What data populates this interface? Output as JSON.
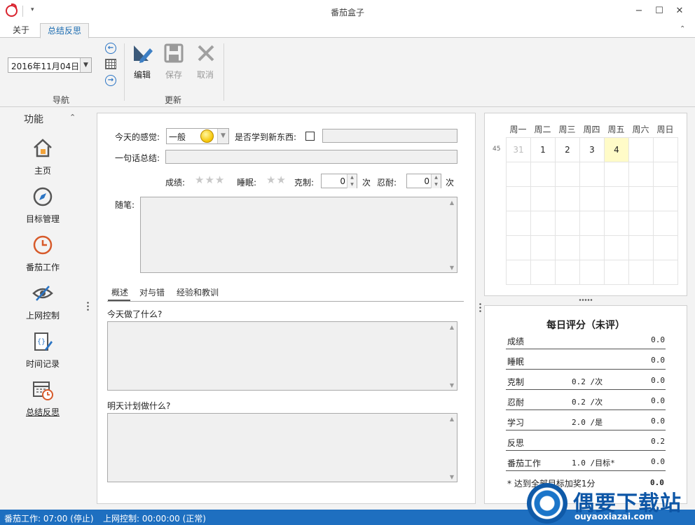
{
  "window": {
    "title": "番茄盒子",
    "min": "−",
    "max": "☐",
    "close": "✕"
  },
  "tabs": [
    {
      "label": "关于"
    },
    {
      "label": "总结反思"
    }
  ],
  "ribbon": {
    "date": "2016年11月04日",
    "nav_group": "导航",
    "update_group": "更新",
    "edit": "编辑",
    "save": "保存",
    "cancel": "取消"
  },
  "sidebar": {
    "title": "功能",
    "items": [
      {
        "label": "主页",
        "icon": "home-icon"
      },
      {
        "label": "目标管理",
        "icon": "compass-icon"
      },
      {
        "label": "番茄工作",
        "icon": "clock-icon"
      },
      {
        "label": "上网控制",
        "icon": "eye-slash-icon"
      },
      {
        "label": "时间记录",
        "icon": "code-pen-icon"
      },
      {
        "label": "总结反思",
        "icon": "calendar-clock-icon"
      }
    ]
  },
  "form": {
    "feeling_label": "今天的感觉:",
    "feeling_value": "一般",
    "learned_label": "是否学到新东西:",
    "summary_label": "一句话总结:",
    "grade_label": "成绩:",
    "sleep_label": "睡眠:",
    "restraint_label": "克制:",
    "restraint_value": "0",
    "restraint_unit": "次",
    "endure_label": "忍耐:",
    "endure_value": "0",
    "endure_unit": "次",
    "notes_label": "随笔:"
  },
  "subtabs": [
    "概述",
    "对与错",
    "经验和教训"
  ],
  "review": {
    "today_label": "今天做了什么?",
    "tomorrow_label": "明天计划做什么?"
  },
  "calendar": {
    "weekdays": [
      "周一",
      "周二",
      "周三",
      "周四",
      "周五",
      "周六",
      "周日"
    ],
    "week_number": "45",
    "days": [
      "31",
      "1",
      "2",
      "3",
      "4",
      "",
      ""
    ],
    "selected_index": 4
  },
  "score": {
    "title": "每日评分（未评）",
    "rows": [
      {
        "name": "成绩",
        "weight": "",
        "value": "0.0"
      },
      {
        "name": "睡眠",
        "weight": "",
        "value": "0.0"
      },
      {
        "name": "克制",
        "weight": "0.2 /次",
        "value": "0.0"
      },
      {
        "name": "忍耐",
        "weight": "0.2 /次",
        "value": "0.0"
      },
      {
        "name": "学习",
        "weight": "2.0 /是",
        "value": "0.0"
      },
      {
        "name": "反思",
        "weight": "",
        "value": "0.2"
      },
      {
        "name": "番茄工作",
        "weight": "1.0 /目标*",
        "value": "0.0"
      }
    ],
    "note": "* 达到全部目标加奖1分",
    "total": "0.0"
  },
  "status": {
    "pomodoro": "番茄工作: 07:00 (停止)",
    "internet": "上网控制: 00:00:00 (正常)"
  },
  "watermark": {
    "text": "偶要下载站",
    "url": "ouyaoxiazai.com"
  },
  "colors": {
    "accent": "#1e6fc0",
    "selected_day": "#fffbc8",
    "tomato": "#d9232e"
  }
}
